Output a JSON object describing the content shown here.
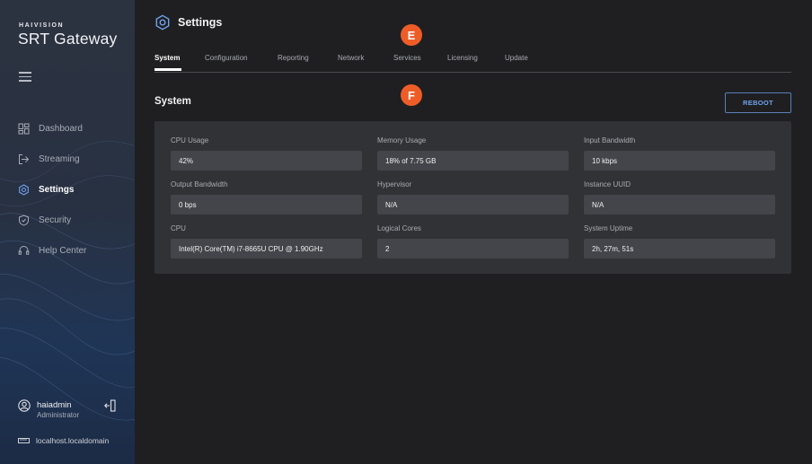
{
  "brand": {
    "company": "HAIVISION",
    "product": "SRT Gateway"
  },
  "sidebar": {
    "items": [
      {
        "label": "Dashboard",
        "icon": "dashboard-icon"
      },
      {
        "label": "Streaming",
        "icon": "streaming-icon"
      },
      {
        "label": "Settings",
        "icon": "gear-icon",
        "active": true
      },
      {
        "label": "Security",
        "icon": "shield-icon"
      },
      {
        "label": "Help Center",
        "icon": "help-icon"
      }
    ],
    "user": {
      "name": "haiadmin",
      "role": "Administrator"
    },
    "host": "localhost.localdomain"
  },
  "page": {
    "title": "Settings",
    "tabs": [
      "System",
      "Configuration",
      "Reporting",
      "Network",
      "Services",
      "Licensing",
      "Update"
    ],
    "active_tab": "System",
    "section_title": "System",
    "reboot_label": "REBOOT",
    "badges": [
      "E",
      "F"
    ]
  },
  "system": {
    "fields": [
      {
        "label": "CPU Usage",
        "value": "42%"
      },
      {
        "label": "Memory Usage",
        "value": "18% of 7.75 GB"
      },
      {
        "label": "Input Bandwidth",
        "value": "10 kbps"
      },
      {
        "label": "Output Bandwidth",
        "value": "0 bps"
      },
      {
        "label": "Hypervisor",
        "value": "N/A"
      },
      {
        "label": "Instance UUID",
        "value": "N/A"
      },
      {
        "label": "CPU",
        "value": "Intel(R) Core(TM) i7-8665U CPU @ 1.90GHz"
      },
      {
        "label": "Logical Cores",
        "value": "2"
      },
      {
        "label": "System Uptime",
        "value": "2h, 27m, 51s"
      }
    ]
  },
  "colors": {
    "accent": "#6ea3ee",
    "badge": "#ee5d28",
    "background": "#1f1f21",
    "panel": "#313236"
  }
}
